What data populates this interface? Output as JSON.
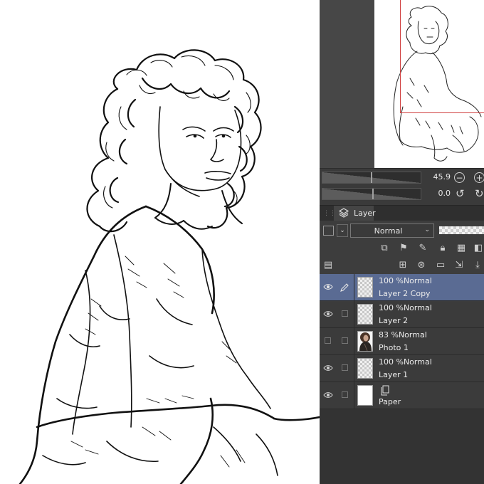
{
  "navigator": {
    "zoom_value": "45.9",
    "rotation_value": "0.0",
    "zoom_out_symbol": "−",
    "zoom_in_symbol": "+",
    "rotate_left_symbol": "↺",
    "rotate_right_symbol": "↻",
    "viewport_outline_color": "#d04040"
  },
  "layer_panel": {
    "tab_label": "Layer",
    "blend_mode": "Normal",
    "selected_color": "#5a6b93",
    "layers": [
      {
        "opacity_mode": "100 %Normal",
        "name": "Layer 2 Copy",
        "visible": true,
        "editing": true,
        "thumb": "checker"
      },
      {
        "opacity_mode": "100 %Normal",
        "name": "Layer 2",
        "visible": true,
        "editing": false,
        "thumb": "checker"
      },
      {
        "opacity_mode": "83 %Normal",
        "name": "Photo 1",
        "visible": false,
        "editing": false,
        "thumb": "photo"
      },
      {
        "opacity_mode": "100 %Normal",
        "name": "Layer 1",
        "visible": true,
        "editing": false,
        "thumb": "checker"
      },
      {
        "opacity_mode": "",
        "name": "Paper",
        "visible": true,
        "editing": false,
        "thumb": "white"
      }
    ]
  },
  "icons": {
    "layer_tab": "layers-stack-icon",
    "visibility": "eye-icon",
    "editing": "pencil-icon",
    "paper": "paper-page-icon",
    "panel_menu": "panel-menu-icon"
  }
}
